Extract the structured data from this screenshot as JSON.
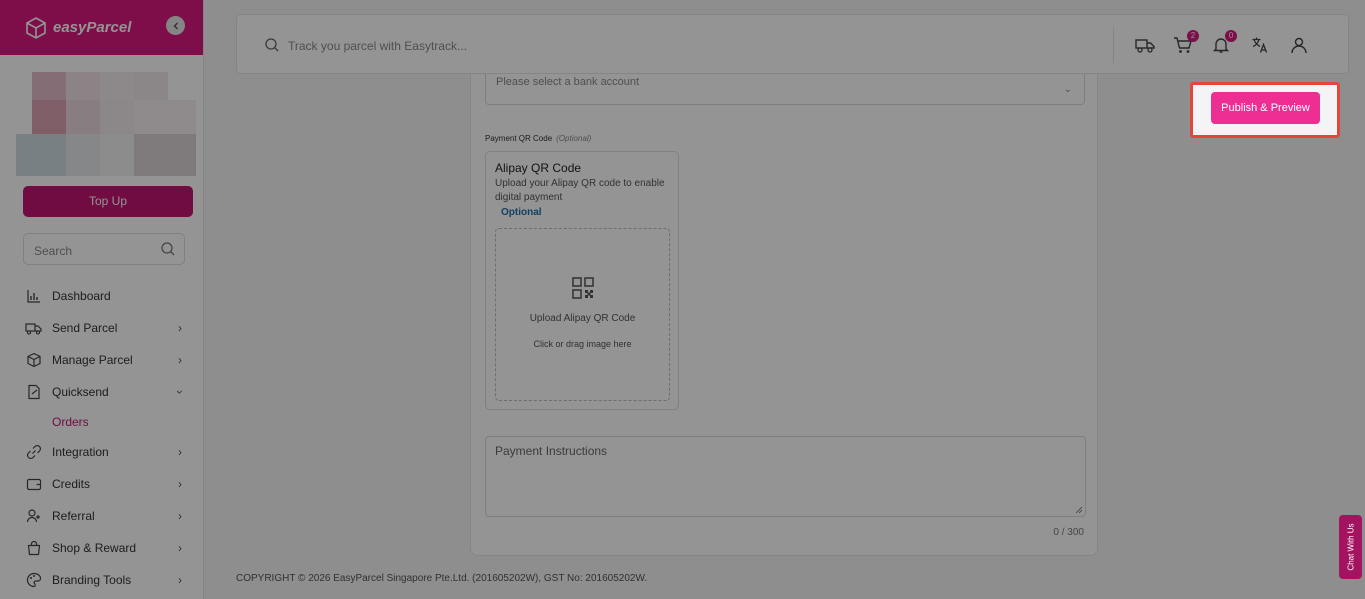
{
  "brand": {
    "name": "easyParcel"
  },
  "sidebar": {
    "collapse_icon": "chevron-left-icon",
    "topup_label": "Top Up",
    "search_placeholder": "Search",
    "items": [
      {
        "label": "Dashboard",
        "icon": "bar-chart-icon",
        "has_chevron": false
      },
      {
        "label": "Send Parcel",
        "icon": "truck-icon",
        "has_chevron": true
      },
      {
        "label": "Manage Parcel",
        "icon": "box-icon",
        "has_chevron": true
      },
      {
        "label": "Quicksend",
        "icon": "document-send-icon",
        "has_chevron": true,
        "expanded": true
      },
      {
        "label": "Integration",
        "icon": "link-icon",
        "has_chevron": true
      },
      {
        "label": "Credits",
        "icon": "wallet-icon",
        "has_chevron": true
      },
      {
        "label": "Referral",
        "icon": "user-add-icon",
        "has_chevron": true
      },
      {
        "label": "Shop & Reward",
        "icon": "shopping-bag-icon",
        "has_chevron": true
      },
      {
        "label": "Branding Tools",
        "icon": "palette-icon",
        "has_chevron": true
      }
    ],
    "subitem_orders": "Orders"
  },
  "header": {
    "search_placeholder": "Track you parcel with Easytrack...",
    "cart_count": "2",
    "notification_count": "0"
  },
  "form": {
    "bank_select_text": "Please select a bank account",
    "qr_section_label": "Payment QR Code",
    "qr_section_optional": "(Optional)",
    "qr_card": {
      "title": "Alipay QR Code",
      "description": "Upload your Alipay QR code to enable digital payment",
      "badge": "Optional",
      "upload_title": "Upload Alipay QR Code",
      "upload_hint": "Click or drag image here"
    },
    "instructions_placeholder": "Payment Instructions",
    "char_counter": "0 / 300"
  },
  "publish_label": "Publish & Preview",
  "footer": "COPYRIGHT © 2026 EasyParcel Singapore Pte.Ltd. (201605202W), GST No: 201605202W.",
  "chat_label": "Chat With Us",
  "colors": {
    "brand": "#d8197f",
    "publish": "#ee2e93",
    "highlight": "#e4463d"
  }
}
